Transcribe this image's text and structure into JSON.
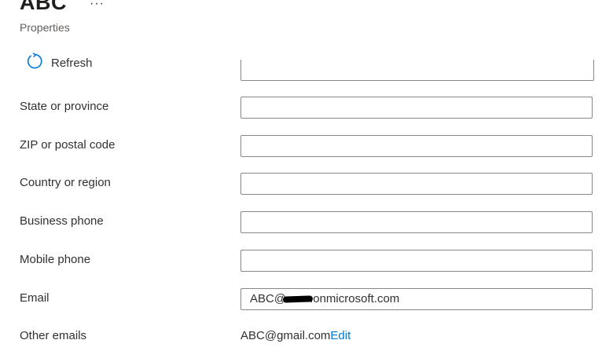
{
  "header": {
    "title": "ABC",
    "more_label": "···",
    "subtitle": "Properties"
  },
  "toolbar": {
    "refresh_label": "Refresh",
    "refresh_icon": "refresh-icon"
  },
  "form": {
    "state": {
      "label": "State or province",
      "value": ""
    },
    "zip": {
      "label": "ZIP or postal code",
      "value": ""
    },
    "country": {
      "label": "Country or region",
      "value": ""
    },
    "business_phone": {
      "label": "Business phone",
      "value": ""
    },
    "mobile_phone": {
      "label": "Mobile phone",
      "value": ""
    },
    "email": {
      "label": "Email",
      "value_prefix": "ABC@",
      "value_suffix": ".onmicrosoft.com"
    },
    "other_emails": {
      "label": "Other emails",
      "value": "ABC@gmail.com",
      "edit_label": "Edit"
    }
  },
  "colors": {
    "accent": "#0078d4",
    "text": "#323130",
    "border": "#8a8886"
  }
}
